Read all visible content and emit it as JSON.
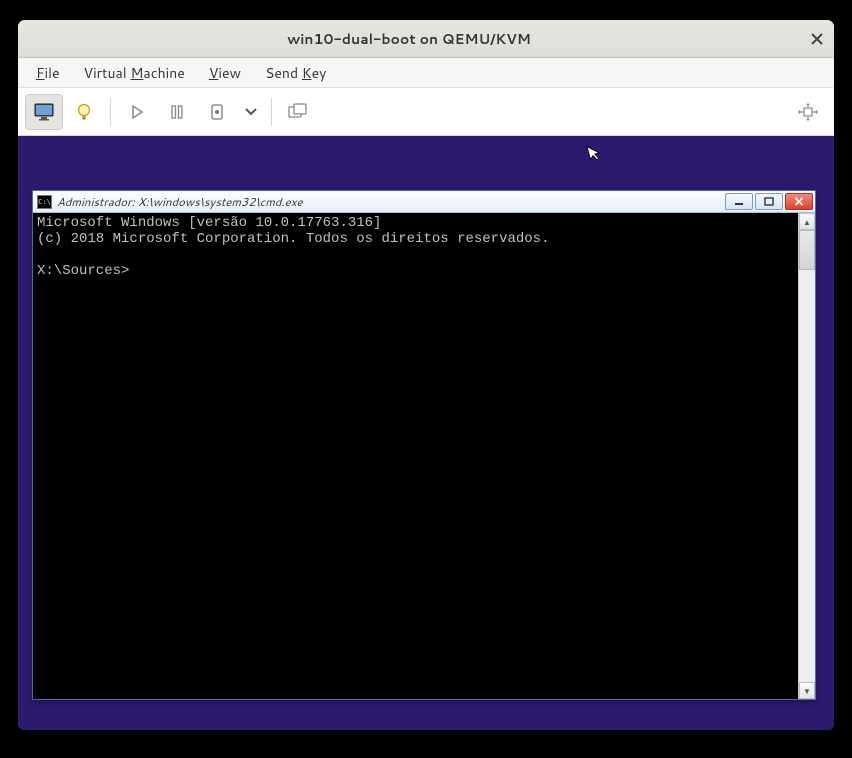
{
  "window": {
    "title": "win10-dual-boot on QEMU/KVM"
  },
  "menu": {
    "file": "File",
    "file_u": "F",
    "virtual_machine": "Virtual Machine",
    "vm_u": "M",
    "view": "View",
    "view_u": "V",
    "send_key": "Send Key",
    "send_key_u": "K"
  },
  "toolbar": {
    "monitor": "monitor-icon",
    "bulb": "lightbulb-icon",
    "play": "play-icon",
    "pause": "pause-icon",
    "shutdown": "power-icon",
    "dropdown": "chevron-down-icon",
    "snapshots": "snapshots-icon",
    "fullscreen": "fullscreen-icon"
  },
  "cmd": {
    "title": "Administrador: X:\\windows\\system32\\cmd.exe",
    "line1": "Microsoft Windows [versão 10.0.17763.316]",
    "line2": "(c) 2018 Microsoft Corporation. Todos os direitos reservados.",
    "prompt": "X:\\Sources>"
  }
}
